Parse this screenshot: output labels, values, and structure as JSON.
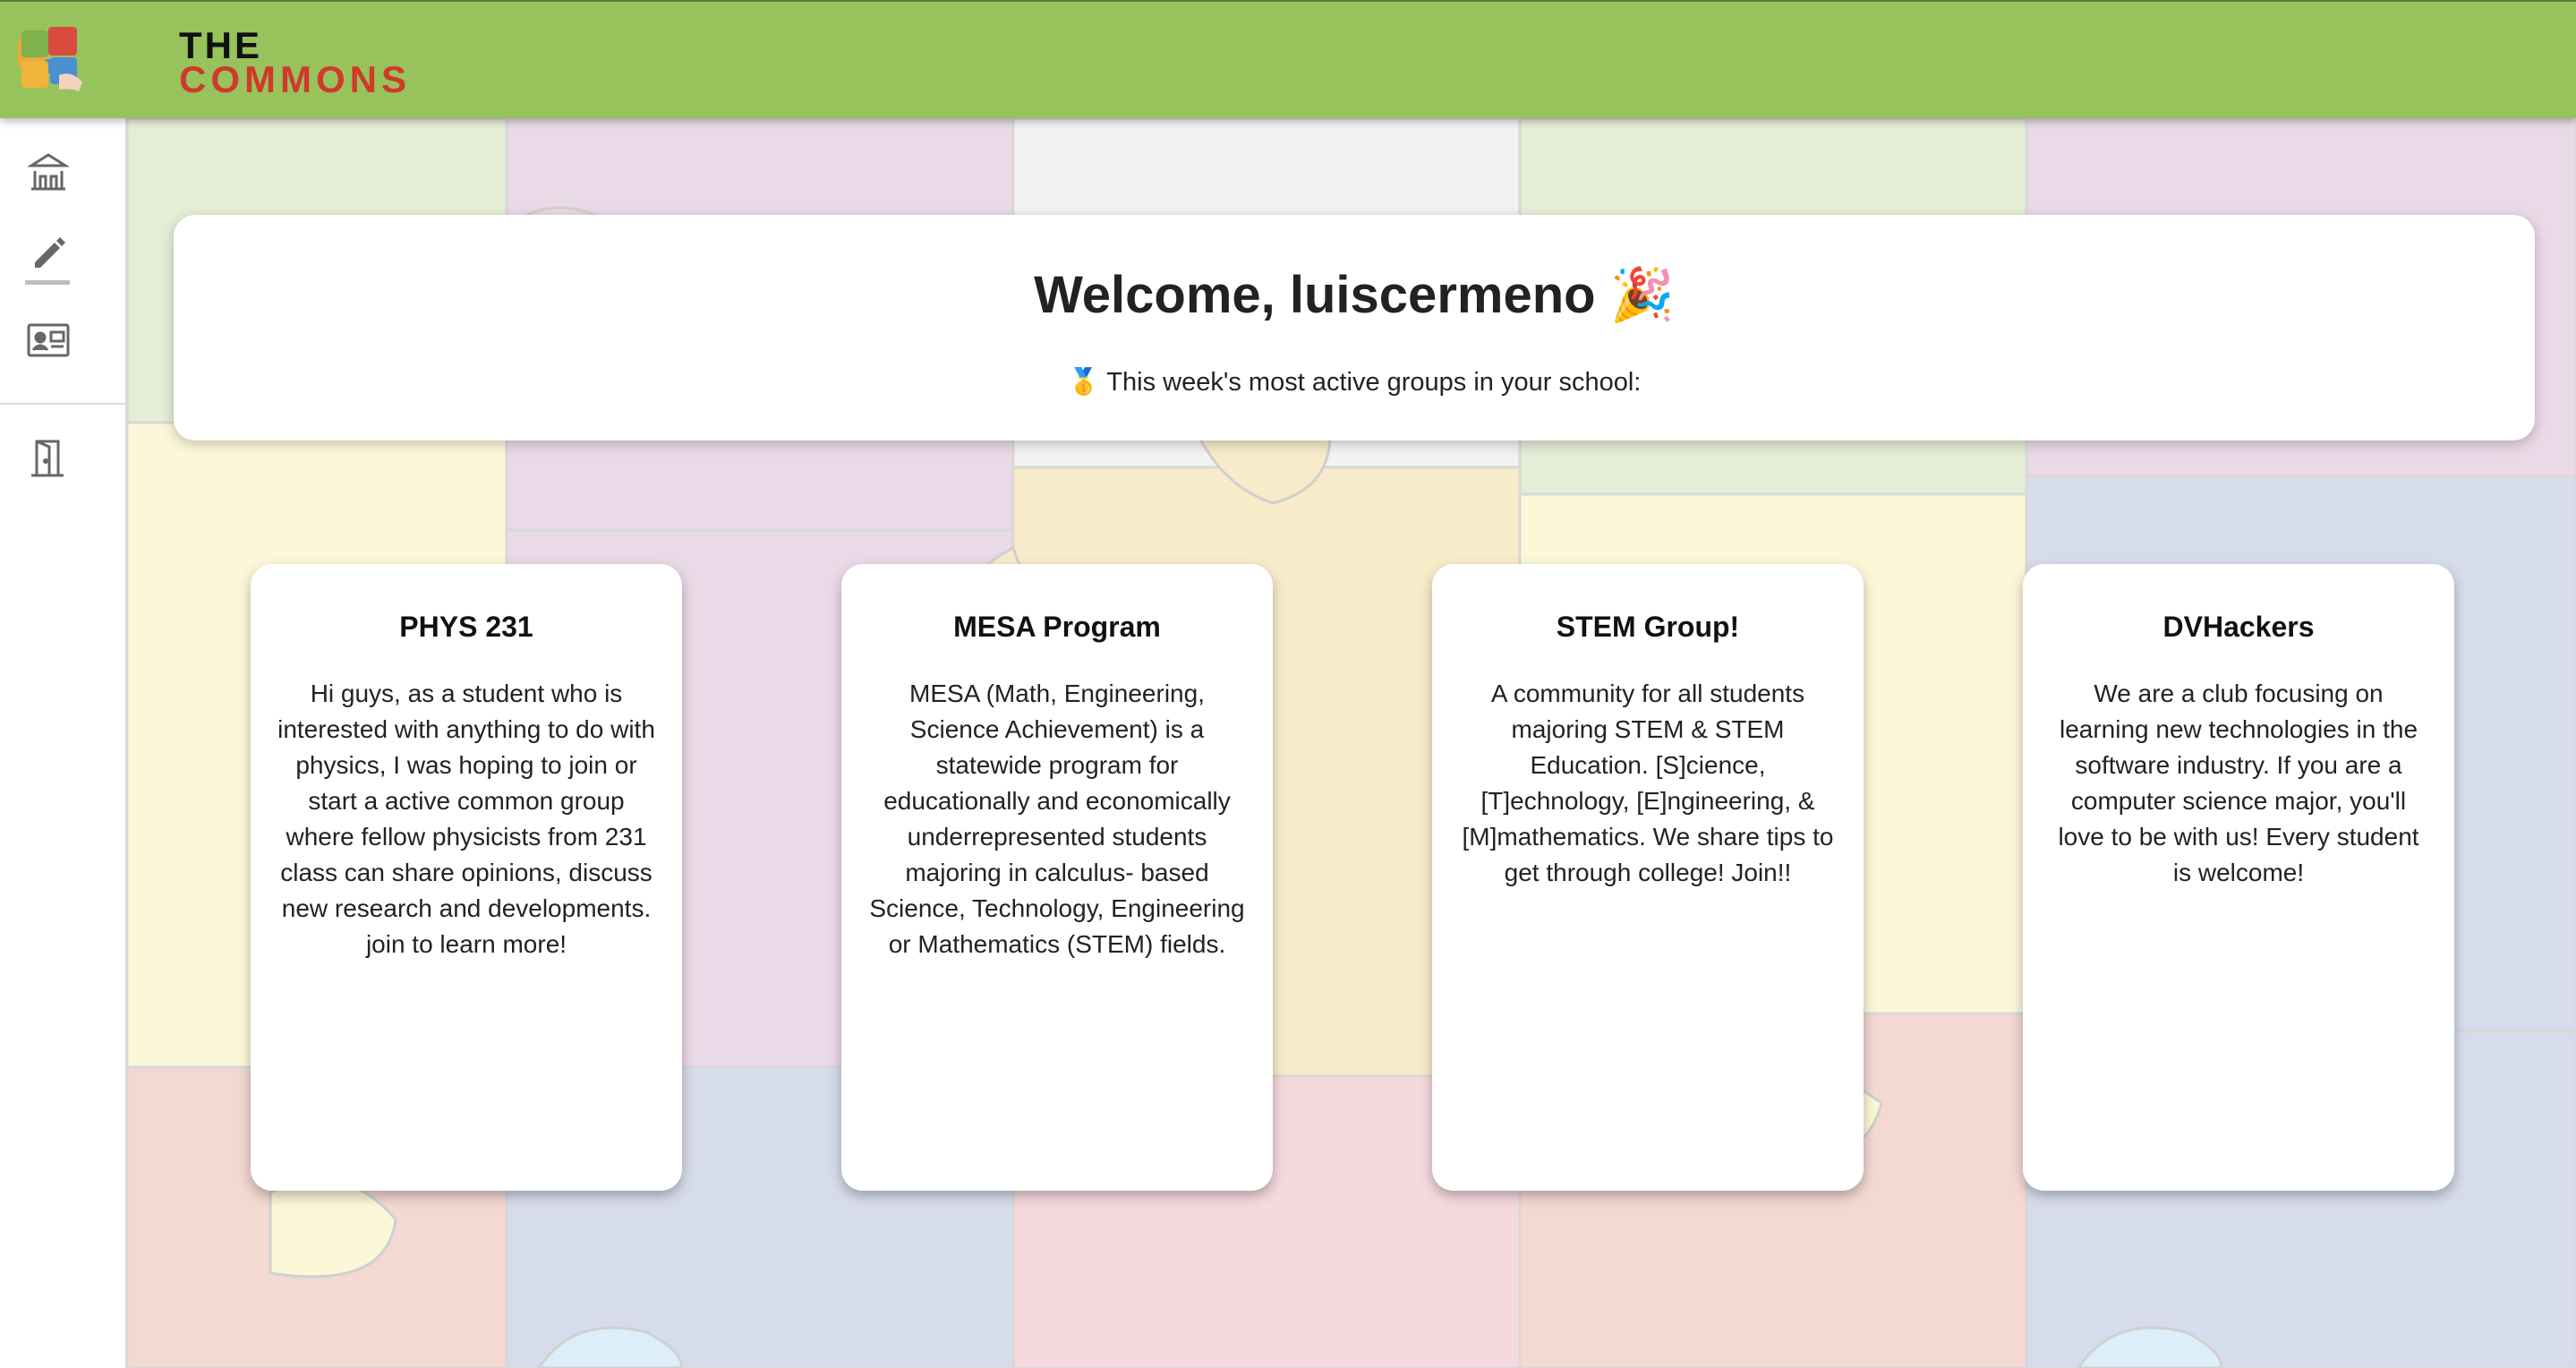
{
  "app": {
    "brand_line1": "THE",
    "brand_line2": "COMMONS",
    "colors": {
      "topbar": "#98c35c",
      "brand_red": "#d03a2c"
    }
  },
  "sidebar": {
    "items": [
      {
        "icon": "school-icon"
      },
      {
        "icon": "pencil-icon",
        "active": true
      },
      {
        "icon": "contact-card-icon"
      },
      {
        "icon": "door-exit-icon"
      }
    ]
  },
  "welcome": {
    "title": "Welcome, luiscermeno 🎉",
    "subtitle": "🥇 This week's most active groups in your school:"
  },
  "groups": [
    {
      "title": "PHYS 231",
      "description": "Hi guys, as a student who is interested with anything to do with physics, I was hoping to join or start a active common group where fellow physicists from 231 class can share opinions, discuss new research and developments. join to learn more!"
    },
    {
      "title": "MESA Program",
      "description": "MESA (Math, Engineering, Science Achievement) is a statewide program for educationally and economically underrepresented students majoring in calculus- based Science, Technology, Engineering or Mathematics (STEM) fields."
    },
    {
      "title": "STEM Group!",
      "description": "A community for all students majoring STEM & STEM Education. [S]cience, [T]echnology, [E]ngineering, & [M]mathematics. We share tips to get through college! Join!!"
    },
    {
      "title": "DVHackers",
      "description": "We are a club focusing on learning new technologies in the software industry. If you are a computer science major, you'll love to be with us! Every student is welcome!"
    }
  ]
}
